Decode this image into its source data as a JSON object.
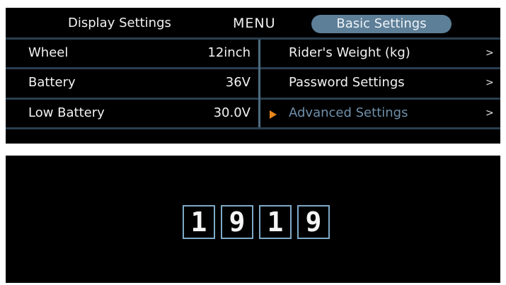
{
  "tabs": {
    "display_settings": "Display Settings",
    "menu": "MENU",
    "basic_settings": "Basic Settings"
  },
  "left_rows": [
    {
      "label": "Wheel",
      "value": "12inch"
    },
    {
      "label": "Battery",
      "value": "36V"
    },
    {
      "label": "Low Battery",
      "value": "30.0V"
    }
  ],
  "right_rows": [
    {
      "label": "Rider's Weight (kg)",
      "chevron": ">"
    },
    {
      "label": "Password Settings",
      "chevron": ">"
    },
    {
      "label": "Advanced Settings",
      "chevron": ">"
    }
  ],
  "selected_item": "Advanced Settings",
  "password_digits": [
    "1",
    "9",
    "1",
    "9"
  ],
  "colors": {
    "accent_tab": "#5e7f98",
    "selected_text": "#6f90ab",
    "selector_arrow": "#e8861c",
    "digit_border": "#7ea9c7"
  },
  "icons": {
    "selector": "triangle-right-icon",
    "row_chevron": "chevron-right-icon"
  }
}
